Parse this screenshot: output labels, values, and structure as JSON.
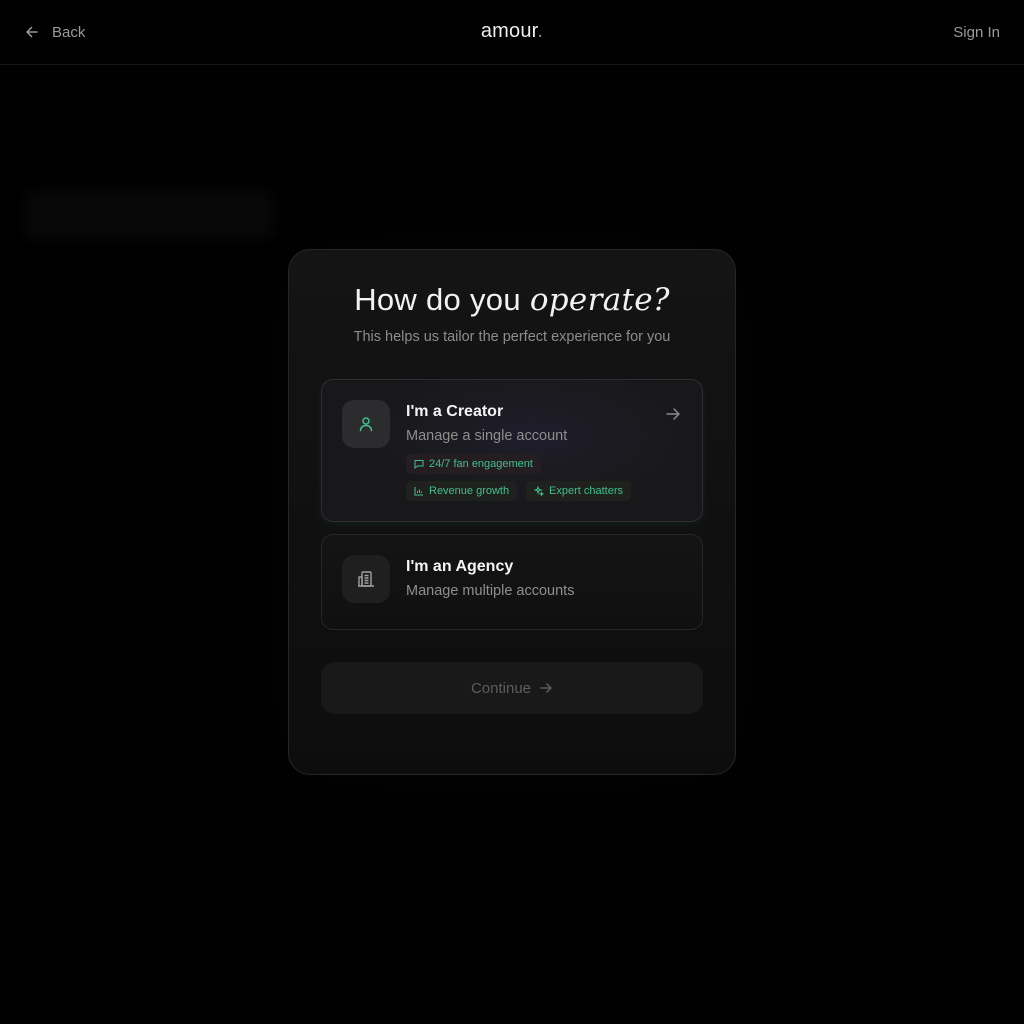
{
  "header": {
    "back_label": "Back",
    "brand": "amour",
    "brand_dot": ".",
    "signin_label": "Sign In"
  },
  "card": {
    "title_plain": "How do you",
    "title_italic": "operate?",
    "subtitle": "This helps us tailor the perfect experience for you"
  },
  "options": {
    "creator": {
      "title": "I'm a Creator",
      "description": "Manage a single account",
      "icon": "user-icon",
      "tags": [
        {
          "label": "24/7 fan engagement",
          "icon": "message-icon"
        },
        {
          "label": "Revenue growth",
          "icon": "bar-chart-icon"
        },
        {
          "label": "Expert chatters",
          "icon": "sparkle-icon"
        }
      ]
    },
    "agency": {
      "title": "I'm an Agency",
      "description": "Manage multiple accounts",
      "icon": "building-icon"
    }
  },
  "continue_label": "Continue",
  "colors": {
    "accent": "#3fbf8f",
    "background": "#000000",
    "card": "#111111"
  }
}
